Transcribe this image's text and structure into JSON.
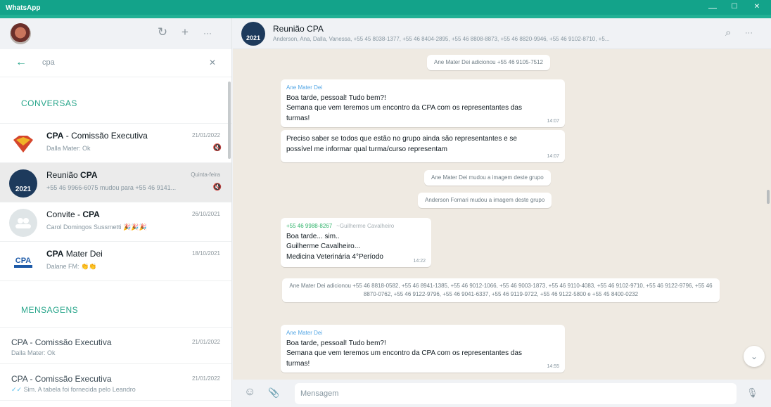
{
  "app": {
    "title": "WhatsApp",
    "minimize": "—",
    "maximize": "☐",
    "close": "✕"
  },
  "sidebar": {
    "header_icons": {
      "status": "↻",
      "new_chat": "+",
      "menu": "···"
    },
    "search": {
      "back": "←",
      "value": "cpa",
      "clear": "✕"
    },
    "sections": {
      "conversations": "CONVERSAS",
      "messages": "MENSAGENS"
    },
    "chats": [
      {
        "name_plain": "",
        "name_bold": "CPA",
        "name_after": " - Comissão Executiva",
        "date": "21/01/2022",
        "preview": "Dalla Mater: Ok",
        "icon": "🔇"
      },
      {
        "name_plain": "Reunião ",
        "name_bold": "CPA",
        "name_after": "",
        "date": "Quinta-feira",
        "preview": "+55 46 9966-6075 mudou para +55 46 9141...",
        "icon": "🔇"
      },
      {
        "name_plain": "Convite - ",
        "name_bold": "CPA",
        "name_after": "",
        "date": "26/10/2021",
        "preview": "Carol Domingos Sussmetti 🎉🎉🎉",
        "icon": ""
      },
      {
        "name_plain": "",
        "name_bold": "CPA",
        "name_after": " Mater Dei",
        "date": "18/10/2021",
        "preview": "Dalane FM: 👏👏",
        "icon": ""
      }
    ],
    "messages": [
      {
        "title": "CPA - Comissão Executiva",
        "date": "21/01/2022",
        "preview": "Dalla Mater: Ok",
        "tick": ""
      },
      {
        "title": "CPA - Comissão Executiva",
        "date": "21/01/2022",
        "preview": "Sim. A tabela foi fornecida pelo Leandro",
        "tick": "✓✓"
      }
    ]
  },
  "chat": {
    "name": "Reunião CPA",
    "avatar_text": "2021",
    "members": "Anderson, Ana, Dalla, Vanessa, +55 45 8038-1377, +55 46 8404-2895, +55 46 8808-8873, +55 46 8820-9946, +55 46 9102-8710, +5...",
    "search_icon": "⌕",
    "menu_icon": "···",
    "items": [
      {
        "kind": "sys",
        "text": "Ane Mater Dei adicionou +55 46 9105-7512"
      },
      {
        "kind": "msg",
        "sender": "Ane Mater Dei",
        "lines": [
          "Boa tarde, pessoal! Tudo bem?!",
          "Semana que vem teremos um encontro da CPA com os representantes das",
          "turmas!"
        ],
        "time": "14:07"
      },
      {
        "kind": "msg",
        "sender": "",
        "lines": [
          "Preciso saber se todos que estão no grupo ainda são representantes e se",
          "possível me informar qual turma/curso representam"
        ],
        "time": "14:07"
      },
      {
        "kind": "sys",
        "text": "Ane Mater Dei mudou a imagem deste grupo"
      },
      {
        "kind": "sys",
        "text": "Anderson Fornari mudou a imagem deste grupo"
      },
      {
        "kind": "msg",
        "sender": "+55 46 9988-8267",
        "alt": "~Guilherme Cavalheiro",
        "lines": [
          "Boa tarde... sim..",
          "Guilherme Cavalheiro...",
          "Medicina Veterinária 4°Período"
        ],
        "time": "14:22"
      },
      {
        "kind": "sys",
        "text": "Ane Mater Dei adicionou +55 46 8818-0582, +55 46 8941-1385, +55 46 9012-1066, +55 46 9003-1873, +55 46 9110-4083, +55 46 9102-9710, +55 46 9122-9796, +55 46 8870-0762, +55 46 9122-9796, +55 46 9041-6337, +55 46 9119-9722, +55 46 9122-5800 e +55 45 8400-0232"
      },
      {
        "kind": "msg",
        "sender": "Ane Mater Dei",
        "lines": [
          "Boa tarde, pessoal! Tudo bem?!",
          "Semana que vem teremos um encontro da CPA com os representantes das",
          "turmas!"
        ],
        "time": "14:55"
      }
    ],
    "scroll_down": "⌄"
  },
  "composer": {
    "emoji": "☺",
    "attach": "📎",
    "placeholder": "Mensagem",
    "mic": "🎙"
  }
}
